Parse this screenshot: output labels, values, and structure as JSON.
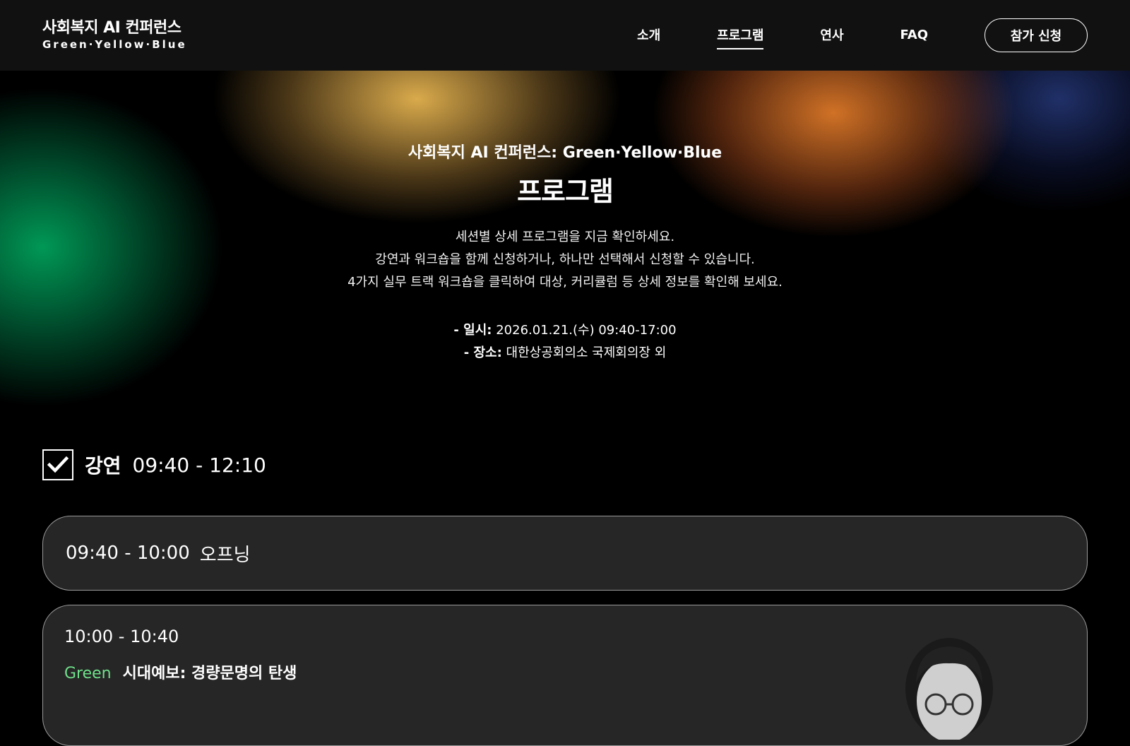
{
  "header": {
    "logo_main": "사회복지 AI 컨퍼런스",
    "logo_sub": "Green·Yellow·Blue",
    "nav": [
      {
        "label": "소개"
      },
      {
        "label": "프로그램"
      },
      {
        "label": "연사"
      },
      {
        "label": "FAQ"
      }
    ],
    "active_nav": "프로그램",
    "apply_label": "참가 신청"
  },
  "hero": {
    "eyebrow": "사회복지 AI 컨퍼런스: Green·Yellow·Blue",
    "title": "프로그램",
    "desc_lines": [
      "세션별 상세 프로그램을 지금 확인하세요.",
      "강연과 워크숍을 함께 신청하거나, 하나만 선택해서 신청할 수 있습니다.",
      "4가지 실무 트랙 워크숍을 클릭하여 대상, 커리큘럼 등 상세 정보를 확인해 보세요."
    ],
    "date_label": "- 일시:",
    "date_value": "2026.01.21.(수) 09:40-17:00",
    "place_label": "- 장소:",
    "place_value": "대한상공회의소 국제회의장 외"
  },
  "section": {
    "checked": true,
    "title": "강연",
    "time": "09:40 - 12:10"
  },
  "sessions": [
    {
      "time": "09:40 - 10:00",
      "title": "오프닝"
    },
    {
      "time": "10:00 - 10:40",
      "track": "Green",
      "title": "시대예보: 경량문명의 탄생"
    }
  ],
  "colors": {
    "header_bg": "#111111",
    "card_bg": "#262626",
    "track_green": "#6fe08a"
  }
}
